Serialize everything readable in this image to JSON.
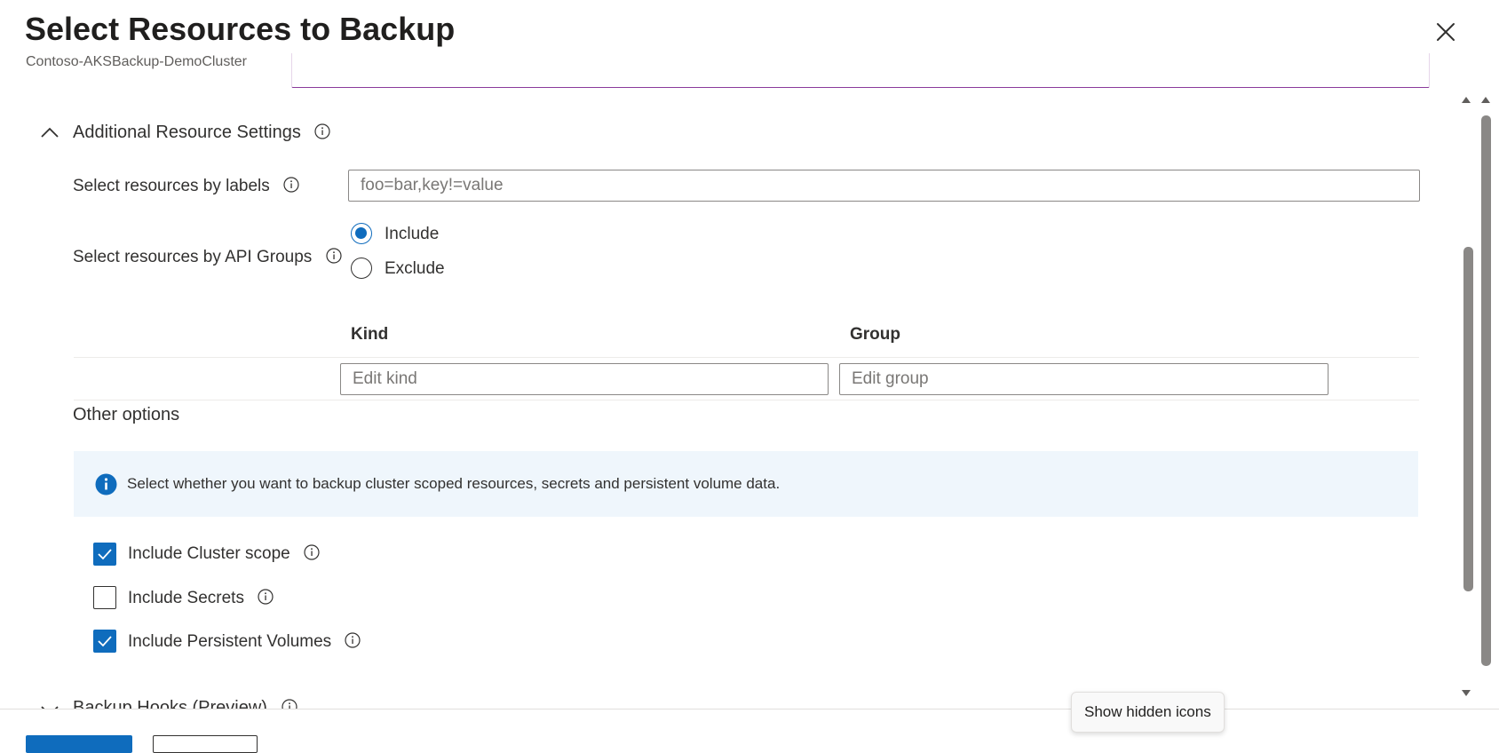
{
  "header": {
    "title": "Select Resources to Backup",
    "subtitle": "Contoso-AKSBackup-DemoCluster"
  },
  "section": {
    "title": "Additional Resource Settings",
    "expanded": true
  },
  "labels_field": {
    "label": "Select resources by labels",
    "placeholder": "foo=bar,key!=value"
  },
  "api_groups": {
    "label": "Select resources by API Groups",
    "options": [
      {
        "label": "Include",
        "selected": true
      },
      {
        "label": "Exclude",
        "selected": false
      }
    ]
  },
  "grid": {
    "columns": [
      "Kind",
      "Group"
    ],
    "kind_placeholder": "Edit kind",
    "group_placeholder": "Edit group"
  },
  "other_options": {
    "title": "Other options",
    "info_text": "Select whether you want to backup cluster scoped resources, secrets and persistent volume data.",
    "checkboxes": [
      {
        "label": "Include Cluster scope",
        "checked": true
      },
      {
        "label": "Include Secrets",
        "checked": false
      },
      {
        "label": "Include Persistent Volumes",
        "checked": true
      }
    ]
  },
  "next_section": {
    "title": "Backup Hooks (Preview)"
  },
  "tooltip": "Show hidden icons",
  "colors": {
    "accent": "#0f6cbd",
    "infobar_bg": "#eff6fc",
    "text": "#323130"
  }
}
